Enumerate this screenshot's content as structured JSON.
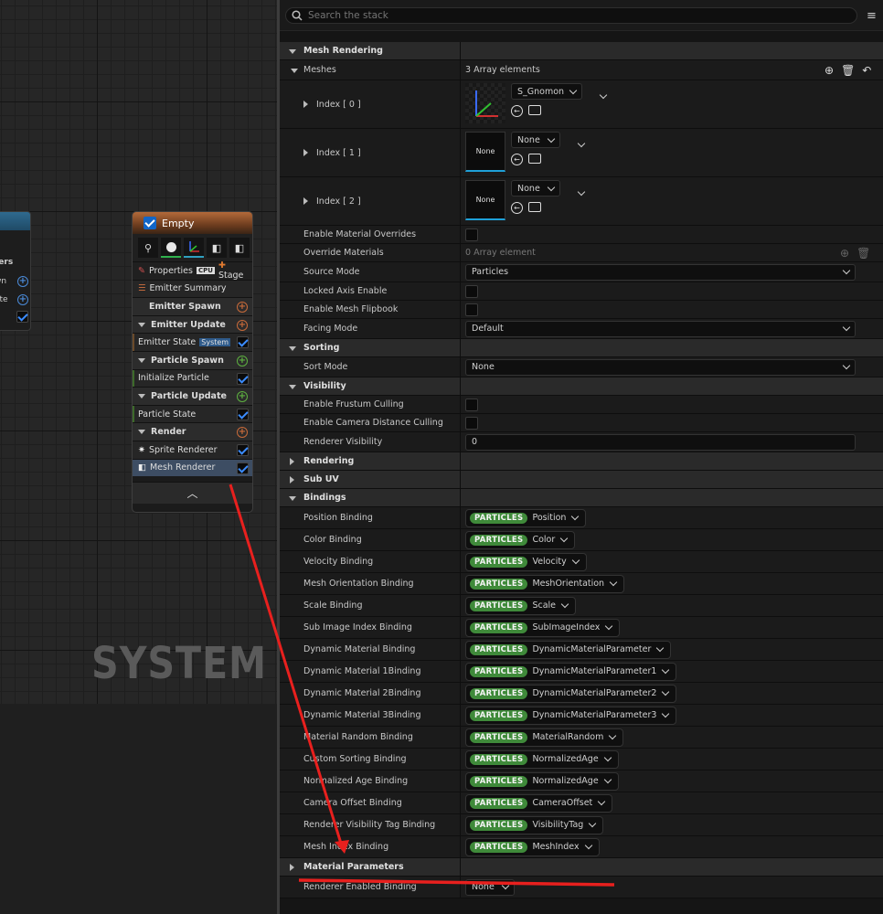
{
  "graph": {
    "watermark": "SYSTEM",
    "left_node": {
      "rows": [
        "ters",
        "wn",
        "ate"
      ]
    }
  },
  "node": {
    "title": "Empty",
    "properties": "Properties",
    "cpu": "CPU",
    "stage": "+ Stage",
    "rows": [
      {
        "label": "Emitter Summary",
        "kind": "item",
        "icon": "list-icon"
      },
      {
        "label": "Emitter Spawn",
        "kind": "head",
        "plus": "orange"
      },
      {
        "label": "Emitter Update",
        "kind": "head",
        "plus": "orange",
        "tri": true
      },
      {
        "label": "Emitter State",
        "badge": "System",
        "kind": "item",
        "check": true,
        "bar": "orange"
      },
      {
        "label": "Particle Spawn",
        "kind": "head",
        "plus": "green",
        "tri": true
      },
      {
        "label": "Initialize Particle",
        "kind": "item",
        "check": true,
        "bar": "green"
      },
      {
        "label": "Particle Update",
        "kind": "head",
        "plus": "green",
        "tri": true
      },
      {
        "label": "Particle State",
        "kind": "item",
        "check": true,
        "bar": "green"
      },
      {
        "label": "Render",
        "kind": "head",
        "plus": "orange",
        "tri": true
      },
      {
        "label": "Sprite Renderer",
        "kind": "item",
        "check": true,
        "icon": "sprite-icon"
      },
      {
        "label": "Mesh Renderer",
        "kind": "sel",
        "check": true,
        "icon": "mesh-icon"
      }
    ]
  },
  "search": {
    "placeholder": "Search the stack"
  },
  "props": {
    "mesh_rendering": "Mesh Rendering",
    "meshes": {
      "label": "Meshes",
      "value": "3 Array elements"
    },
    "index": [
      {
        "label": "Index [ 0 ]",
        "mesh": "S_Gnomon"
      },
      {
        "label": "Index [ 1 ]",
        "mesh": "None",
        "thumb": "None"
      },
      {
        "label": "Index [ 2 ]",
        "mesh": "None",
        "thumb": "None"
      }
    ],
    "rows1": [
      {
        "label": "Enable Material Overrides",
        "type": "check"
      },
      {
        "label": "Override Materials",
        "type": "text",
        "value": "0 Array element"
      },
      {
        "label": "Source Mode",
        "type": "dd",
        "value": "Particles"
      },
      {
        "label": "Locked Axis Enable",
        "type": "check"
      },
      {
        "label": "Enable Mesh Flipbook",
        "type": "check"
      },
      {
        "label": "Facing Mode",
        "type": "dd",
        "value": "Default"
      }
    ],
    "sorting": "Sorting",
    "sort_mode": {
      "label": "Sort Mode",
      "value": "None"
    },
    "visibility": "Visibility",
    "vis_rows": [
      {
        "label": "Enable Frustum Culling"
      },
      {
        "label": "Enable Camera Distance Culling"
      }
    ],
    "renderer_visibility": {
      "label": "Renderer Visibility",
      "value": "0"
    },
    "rendering": "Rendering",
    "subuv": "Sub UV",
    "bindings": "Bindings",
    "binding_rows": [
      {
        "label": "Position Binding",
        "tag": "PARTICLES",
        "value": "Position"
      },
      {
        "label": "Color Binding",
        "tag": "PARTICLES",
        "value": "Color"
      },
      {
        "label": "Velocity Binding",
        "tag": "PARTICLES",
        "value": "Velocity"
      },
      {
        "label": "Mesh Orientation Binding",
        "tag": "PARTICLES",
        "value": "MeshOrientation"
      },
      {
        "label": "Scale Binding",
        "tag": "PARTICLES",
        "value": "Scale"
      },
      {
        "label": "Sub Image Index Binding",
        "tag": "PARTICLES",
        "value": "SubImageIndex"
      },
      {
        "label": "Dynamic Material Binding",
        "tag": "PARTICLES",
        "value": "DynamicMaterialParameter"
      },
      {
        "label": "Dynamic Material 1Binding",
        "tag": "PARTICLES",
        "value": "DynamicMaterialParameter1"
      },
      {
        "label": "Dynamic Material 2Binding",
        "tag": "PARTICLES",
        "value": "DynamicMaterialParameter2"
      },
      {
        "label": "Dynamic Material 3Binding",
        "tag": "PARTICLES",
        "value": "DynamicMaterialParameter3"
      },
      {
        "label": "Material Random Binding",
        "tag": "PARTICLES",
        "value": "MaterialRandom"
      },
      {
        "label": "Custom Sorting Binding",
        "tag": "PARTICLES",
        "value": "NormalizedAge"
      },
      {
        "label": "Normalized Age Binding",
        "tag": "PARTICLES",
        "value": "NormalizedAge"
      },
      {
        "label": "Camera Offset Binding",
        "tag": "PARTICLES",
        "value": "CameraOffset"
      },
      {
        "label": "Renderer Visibility Tag Binding",
        "tag": "PARTICLES",
        "value": "VisibilityTag"
      },
      {
        "label": "Mesh Index Binding",
        "tag": "PARTICLES",
        "value": "MeshIndex"
      }
    ],
    "material_parameters": "Material Parameters",
    "renderer_enabled": {
      "label": "Renderer Enabled Binding",
      "value": "None"
    }
  },
  "annotation": {
    "color": "#e8201e"
  }
}
